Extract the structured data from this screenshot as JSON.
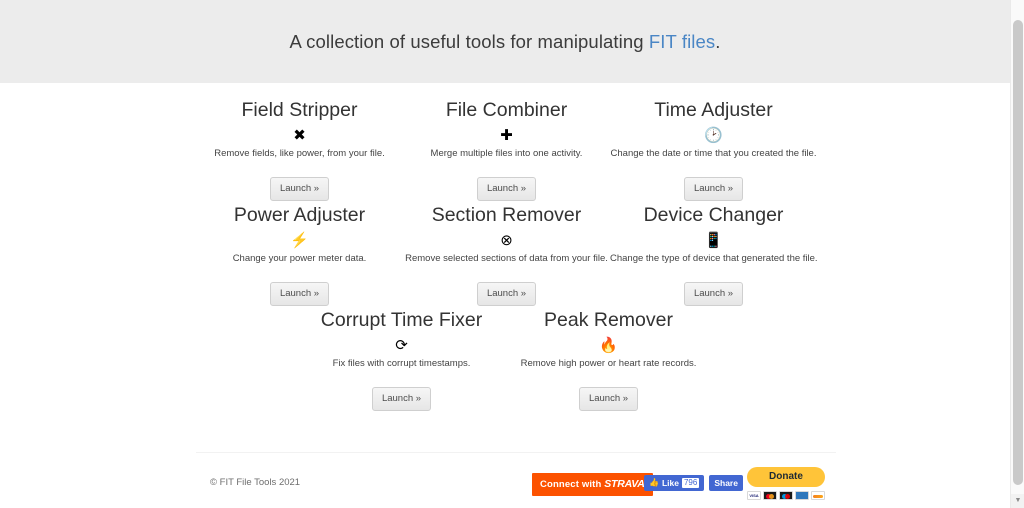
{
  "jumbotron": {
    "lead_prefix": "A collection of useful tools for manipulating ",
    "lead_link": "FIT files",
    "lead_suffix": "."
  },
  "tools": [
    {
      "title": "Field Stripper",
      "icon": "close-x-icon",
      "glyph": "✖",
      "description": "Remove fields, like power, from your file.",
      "button": "Launch »"
    },
    {
      "title": "File Combiner",
      "icon": "plus-icon",
      "glyph": "✚",
      "description": "Merge multiple files into one activity.",
      "button": "Launch »"
    },
    {
      "title": "Time Adjuster",
      "icon": "clock-icon",
      "glyph": "🕑",
      "description": "Change the date or time that you created the file.",
      "button": "Launch »"
    },
    {
      "title": "Power Adjuster",
      "icon": "lightning-bolt-icon",
      "glyph": "⚡",
      "description": "Change your power meter data.",
      "button": "Launch »"
    },
    {
      "title": "Section Remover",
      "icon": "circle-x-icon",
      "glyph": "⊗",
      "description": "Remove selected sections of data from your file.",
      "button": "Launch »"
    },
    {
      "title": "Device Changer",
      "icon": "mobile-device-icon",
      "glyph": "📱",
      "description": "Change the type of device that generated the file.",
      "button": "Launch »"
    },
    {
      "title": "Corrupt Time Fixer",
      "icon": "refresh-icon",
      "glyph": "⟳",
      "description": "Fix files with corrupt timestamps.",
      "button": "Launch »"
    },
    {
      "title": "Peak Remover",
      "icon": "flame-icon",
      "glyph": "🔥",
      "description": "Remove high power or heart rate records.",
      "button": "Launch »"
    }
  ],
  "footer": {
    "copyright": "© FIT File Tools 2021",
    "strava": {
      "prefix": "Connect with ",
      "brand": "STRAVA"
    },
    "facebook": {
      "like_label": "Like",
      "like_count": "796",
      "share_label": "Share",
      "thumb_glyph": "👍"
    },
    "paypal": {
      "donate_label": "Donate",
      "cards": [
        "visa",
        "mastercard",
        "maestro",
        "amex",
        "discover"
      ]
    }
  },
  "colors": {
    "jumbotron_bg": "#ececec",
    "link_blue": "#4a86c5",
    "strava_orange": "#fc5200",
    "facebook_blue": "#4267d2",
    "paypal_yellow": "#ffc439"
  },
  "scrollbar": {
    "down_arrow": "▼"
  }
}
